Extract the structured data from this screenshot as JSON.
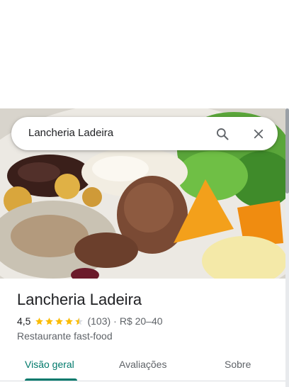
{
  "search": {
    "value": "Lancheria Ladeira",
    "search_icon": "search-icon",
    "close_icon": "close-icon"
  },
  "place": {
    "name": "Lancheria Ladeira",
    "rating": "4,5",
    "stars": 4.5,
    "reviews_count": "(103)",
    "separator": "·",
    "price_range": "R$ 20–40",
    "category": "Restaurante fast-food"
  },
  "tabs": [
    {
      "label": "Visão geral",
      "active": true
    },
    {
      "label": "Avaliações",
      "active": false
    },
    {
      "label": "Sobre",
      "active": false
    }
  ],
  "colors": {
    "accent": "#00796b",
    "star": "#fbbc04",
    "text_primary": "#202124",
    "text_secondary": "#5f6368"
  }
}
